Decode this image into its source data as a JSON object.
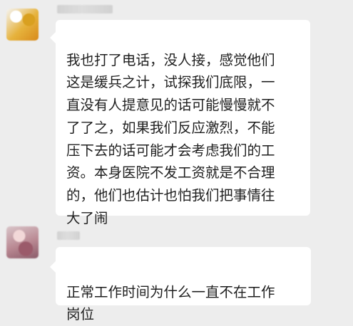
{
  "messages": [
    {
      "text": "我也打了电话，没人接，感觉他们\n这是缓兵之计，试探我们底限，一\n直没有人提意见的话可能慢慢就不\n了了之，如果我们反应激烈，不能\n压下去的话可能才会考虑我们的工\n资。本身医院不发工资就是不合理\n的，他们也估计也怕我们把事情往\n大了闹"
    },
    {
      "text": "正常工作时间为什么一直不在工作\n岗位"
    }
  ]
}
